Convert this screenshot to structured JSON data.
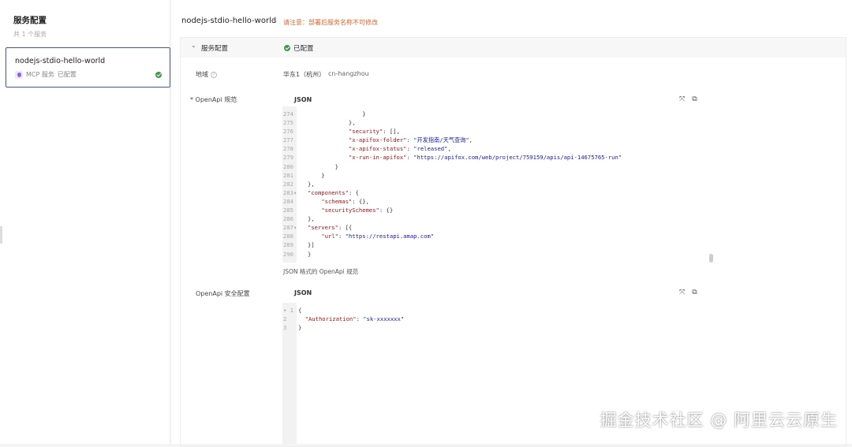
{
  "sidebar": {
    "title": "服务配置",
    "count": "共 1 个服务",
    "service": {
      "name": "nodejs-stdio-hello-world",
      "type": "MCP 服务",
      "status": "已配置"
    }
  },
  "main": {
    "title": "nodejs-stdio-hello-world",
    "warning": "请注意：部署后服务名称不可修改",
    "section": {
      "label": "服务配置",
      "status": "已配置"
    },
    "region": {
      "label": "地域",
      "value": "华东1（杭州）",
      "code": "cn-hangzhou"
    },
    "openapi": {
      "label": "* OpenApi 规范",
      "format": "JSON",
      "hint": "JSON 格式的 OpenApi 规范",
      "lines": [
        {
          "n": "274",
          "c": "                }"
        },
        {
          "n": "275",
          "c": "            },"
        },
        {
          "n": "276",
          "c": "            \"security\": [],"
        },
        {
          "n": "277",
          "c": "            \"x-apifox-folder\": \"开发指南/天气查询\","
        },
        {
          "n": "278",
          "c": "            \"x-apifox-status\": \"released\","
        },
        {
          "n": "279",
          "c": "            \"x-run-in-apifox\": \"https://apifox.com/web/project/759159/apis/api-14675765-run\""
        },
        {
          "n": "280",
          "c": "        }"
        },
        {
          "n": "281",
          "c": "    }"
        },
        {
          "n": "282",
          "c": "},"
        },
        {
          "n": "283▾",
          "c": "\"components\": {"
        },
        {
          "n": "284",
          "c": "    \"schemas\": {},"
        },
        {
          "n": "285",
          "c": "    \"securitySchemes\": {}"
        },
        {
          "n": "286",
          "c": "},"
        },
        {
          "n": "287▾",
          "c": "\"servers\": [{"
        },
        {
          "n": "288",
          "c": "    \"url\": \"https://restapi.amap.com\""
        },
        {
          "n": "289",
          "c": "}]"
        },
        {
          "n": "290",
          "c": "}"
        }
      ]
    },
    "security": {
      "label": "OpenApi 安全配置",
      "format": "JSON",
      "lines": [
        {
          "n": "▾ 1",
          "c": "{"
        },
        {
          "n": "2",
          "c": "  \"Authorization\": \"sk-xxxxxxx\""
        },
        {
          "n": "3",
          "c": "}"
        }
      ]
    }
  },
  "watermark": "掘金技术社区 @ 阿里云云原生"
}
